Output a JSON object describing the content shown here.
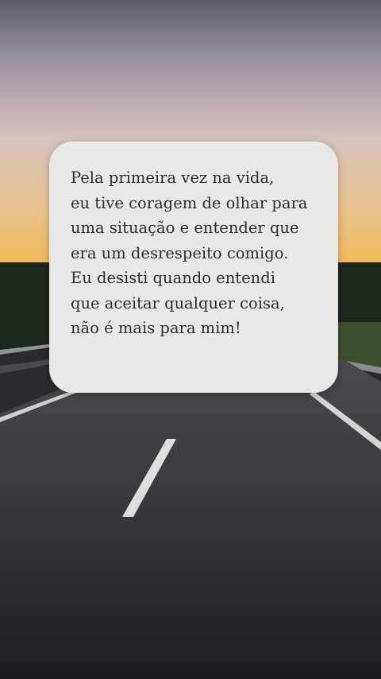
{
  "quote": {
    "lines": [
      "Pela primeira vez na vida,",
      "eu tive coragem de olhar para",
      "uma situação e entender que",
      "era um desrespeito comigo.",
      "Eu desisti quando entendi",
      "que aceitar qualquer coisa,",
      "não é mais para mim!"
    ]
  },
  "background": {
    "scene": "sunset sky over empty highway",
    "colors": {
      "sky_top": "#6e6a78",
      "sky_mid": "#c9b8bf",
      "horizon_glow": "#f0c46a",
      "treeline": "#1f2a1c",
      "road": "#3a3b40",
      "road_line": "#dcdcdc",
      "card": "#e9e8e6",
      "text": "#2d2d2d"
    }
  }
}
